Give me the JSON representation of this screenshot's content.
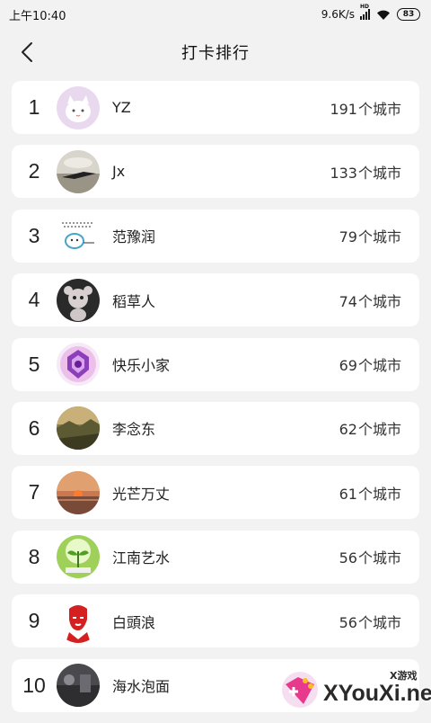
{
  "status_bar": {
    "time": "上午10:40",
    "network_speed": "9.6K/s",
    "hd_label": "HD",
    "battery": "83"
  },
  "header": {
    "title": "打卡排行"
  },
  "unit": "个城市",
  "rankings": [
    {
      "rank": "1",
      "name": "YZ",
      "count": "191"
    },
    {
      "rank": "2",
      "name": "Jx",
      "count": "133"
    },
    {
      "rank": "3",
      "name": "范豫润",
      "count": "79"
    },
    {
      "rank": "4",
      "name": "稻草人",
      "count": "74"
    },
    {
      "rank": "5",
      "name": "快乐小家",
      "count": "69"
    },
    {
      "rank": "6",
      "name": "李念东",
      "count": "62"
    },
    {
      "rank": "7",
      "name": "光芒万丈",
      "count": "61"
    },
    {
      "rank": "8",
      "name": "江南艺水",
      "count": "56"
    },
    {
      "rank": "9",
      "name": "白頭浪",
      "count": "56"
    },
    {
      "rank": "10",
      "name": "海水泡面",
      "count": ""
    }
  ],
  "watermark": {
    "site": "XYouXi.net",
    "label": "X游戏"
  }
}
